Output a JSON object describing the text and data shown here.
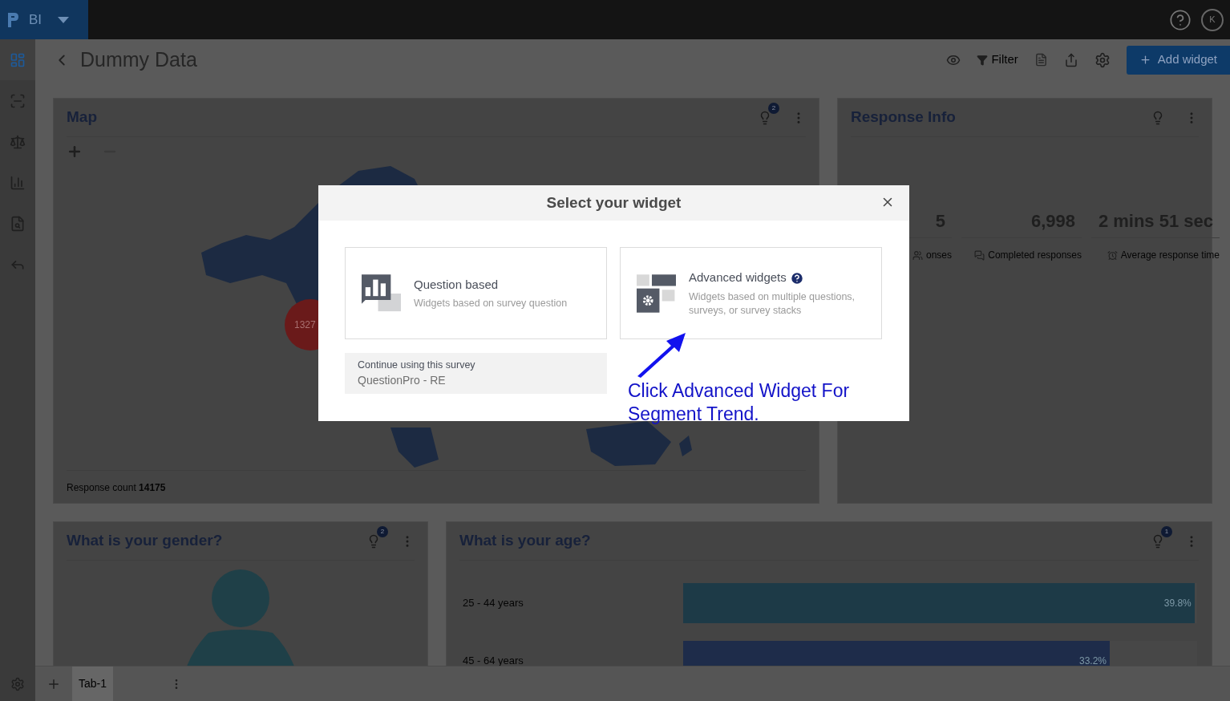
{
  "app_bar": {
    "product": "BI",
    "user_initial": "K"
  },
  "sidebar": {
    "items": [
      {
        "kind": "dashboard",
        "selected": true
      },
      {
        "kind": "scan",
        "selected": false
      },
      {
        "kind": "scale",
        "selected": false
      },
      {
        "kind": "chart",
        "selected": false
      },
      {
        "kind": "file",
        "selected": false
      },
      {
        "kind": "reply",
        "selected": false
      }
    ]
  },
  "header": {
    "title": "Dummy Data",
    "filter": "Filter",
    "add_widget": "Add widget"
  },
  "map": {
    "title": "Map",
    "badge": "2",
    "cluster": "1327",
    "response_count": "Response count **14175**"
  },
  "response_info": {
    "title": "Response Info",
    "stats": [
      {
        "kind": "total",
        "value": "5",
        "label": "onses"
      },
      {
        "kind": "completed",
        "value": "6,998",
        "label": "Completed responses"
      },
      {
        "kind": "time",
        "value": "2 mins 51 sec",
        "label": "Average response time"
      }
    ]
  },
  "gender": {
    "title": "What is your gender?",
    "badge": "2"
  },
  "age": {
    "title": "What is your age?",
    "badge": "1",
    "bars": [
      {
        "label": "25 - 44 years",
        "value": "39.8%",
        "level": 0.995,
        "color": "#1d3a47"
      },
      {
        "label": "45 - 64 years",
        "value": "33.2%",
        "level": 0.83,
        "color": "#1e2c4a"
      }
    ]
  },
  "tabs": [
    {
      "label": "Tab-1",
      "selected": true
    }
  ],
  "modal": {
    "title": "Select your widget",
    "options": [
      {
        "kind": "question",
        "title": "Question based",
        "subtitle": "Widgets based on survey question",
        "help": false
      },
      {
        "kind": "advanced",
        "title": "Advanced widgets",
        "subtitle": "Widgets based on multiple questions, surveys, or survey stacks",
        "help": true
      }
    ],
    "continue": {
      "label": "Continue using this survey",
      "survey": "QuestionPro - RE"
    },
    "annotation": "Click Advanced Widget For Segment Trend."
  }
}
